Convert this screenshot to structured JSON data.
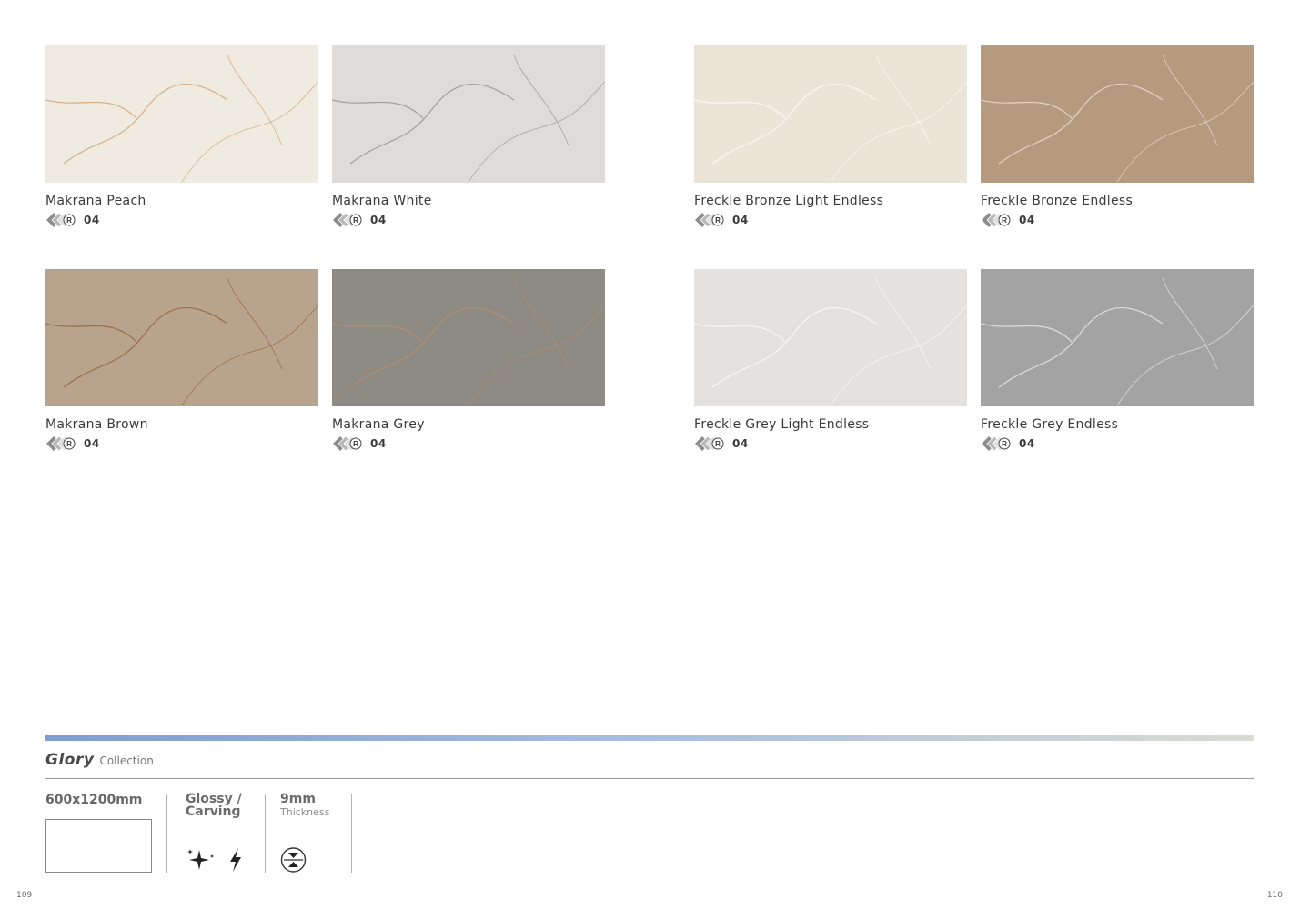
{
  "tiles": [
    {
      "name": "Makrana Peach",
      "faces": "04",
      "color": "#f0ebe1",
      "vein": "#c99a66"
    },
    {
      "name": "Makrana White",
      "faces": "04",
      "color": "#dedbd8",
      "vein": "#8c8c8c"
    },
    {
      "name": "Freckle Bronze Light Endless",
      "faces": "04",
      "color": "#ede4d8",
      "vein": "#ffffff"
    },
    {
      "name": "Freckle Bronze Endless",
      "faces": "04",
      "color": "#b59a7e",
      "vein": "#f1e8df"
    },
    {
      "name": "Makrana Brown",
      "faces": "04",
      "color": "#b8a48c",
      "vein": "#8f5a32"
    },
    {
      "name": "Makrana Grey",
      "faces": "04",
      "color": "#8d8b84",
      "vein": "#c19266"
    },
    {
      "name": "Freckle Grey Light Endless",
      "faces": "04",
      "color": "#e4e2df",
      "vein": "#ffffff"
    },
    {
      "name": "Freckle Grey Endless",
      "faces": "04",
      "color": "#a3a3a3",
      "vein": "#f3f3f3"
    }
  ],
  "collection": {
    "name": "Glory",
    "label": "Collection"
  },
  "specs": {
    "size": "600x1200mm",
    "finish_line1": "Glossy /",
    "finish_line2": "Carving",
    "thickness_value": "9mm",
    "thickness_label": "Thickness"
  },
  "icons": {
    "rating": "random-faces-icon",
    "finish1": "sparkle-icon",
    "finish2": "bolt-icon",
    "thickness": "thickness-icon"
  },
  "page_numbers": {
    "left": "109",
    "right": "110"
  },
  "band_colors": [
    "#7f9dd0",
    "#d8ddd2"
  ]
}
